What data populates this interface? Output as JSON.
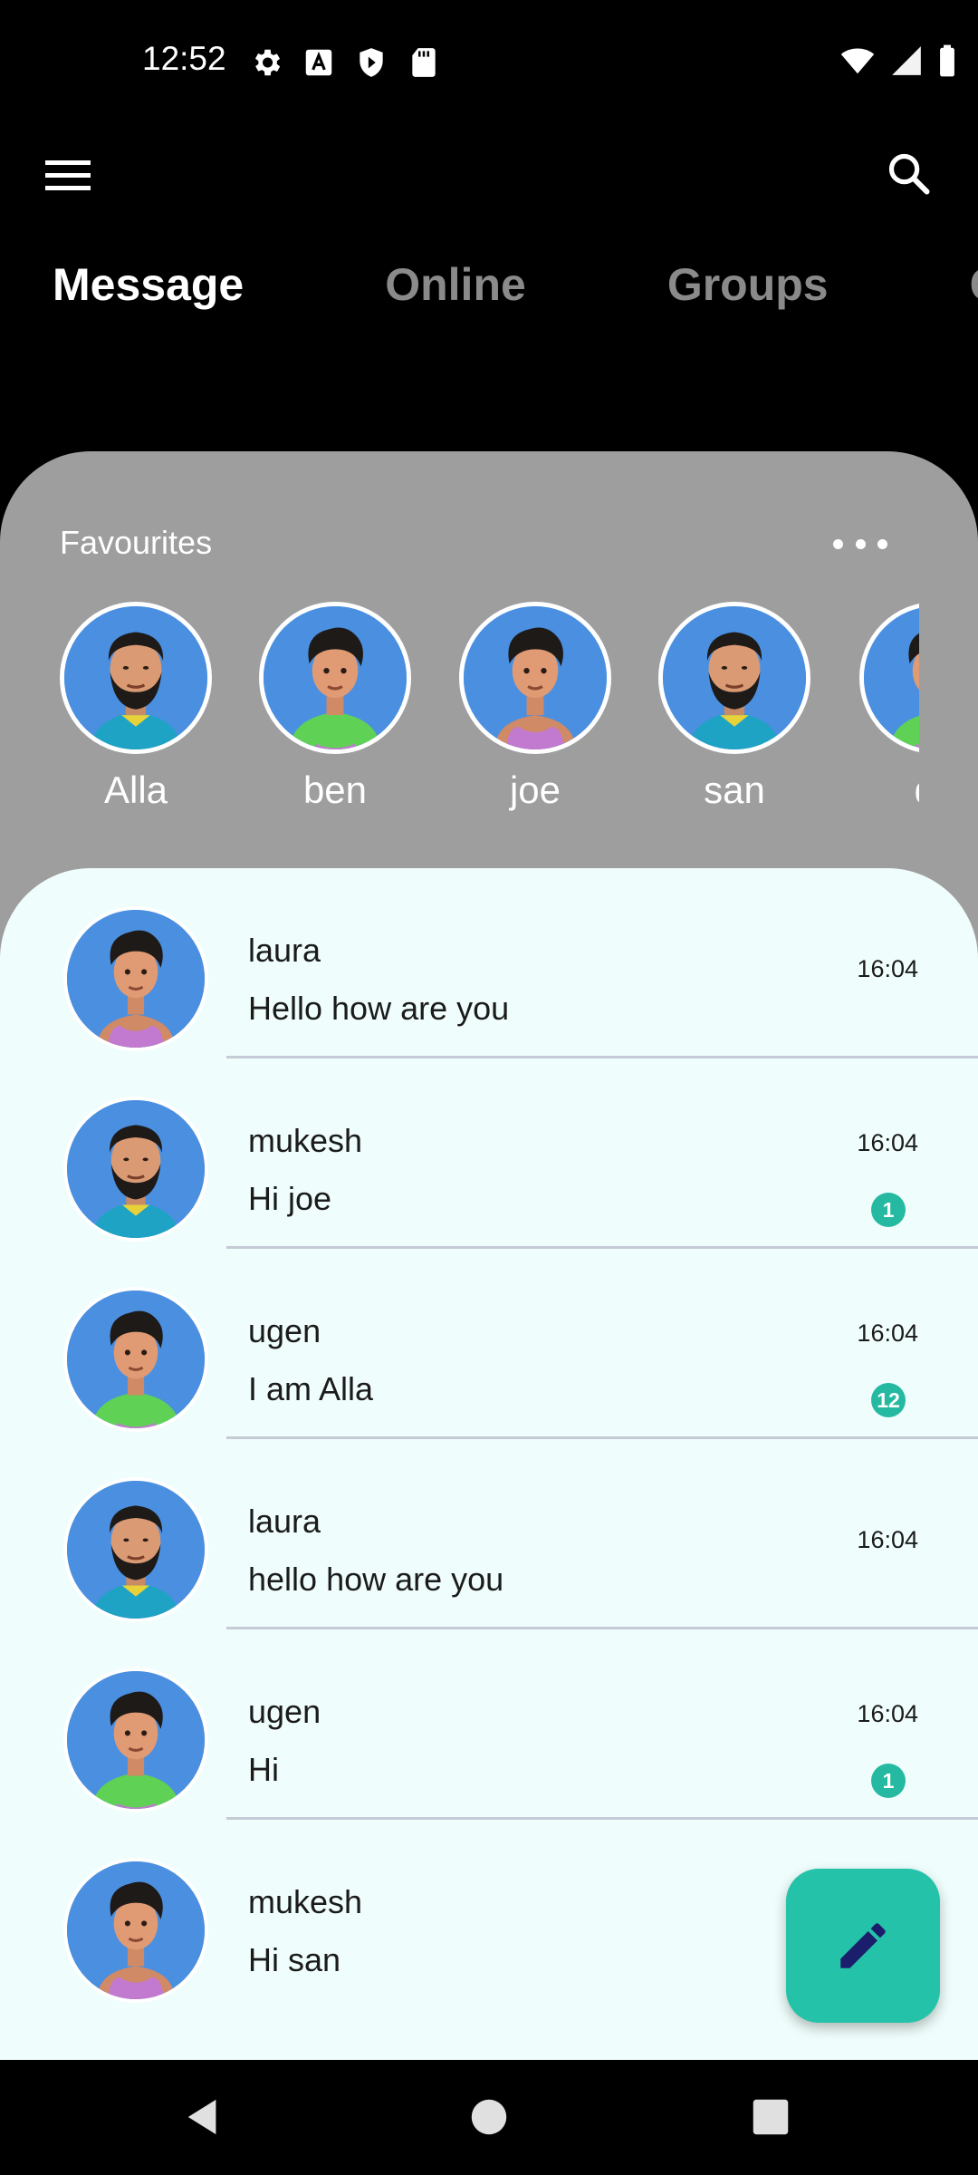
{
  "status_bar": {
    "time": "12:52",
    "left_icons": [
      "gear-icon",
      "font-icon",
      "shield-icon",
      "sd-card-icon"
    ],
    "right_icons": [
      "wifi-icon",
      "signal-icon",
      "battery-icon"
    ]
  },
  "app_bar": {
    "menu_icon": "hamburger-menu-icon",
    "search_icon": "search-icon"
  },
  "tabs": [
    {
      "label": "Message",
      "active": true
    },
    {
      "label": "Online",
      "active": false
    },
    {
      "label": "Groups",
      "active": false
    },
    {
      "label": "C",
      "active": false
    }
  ],
  "favourites": {
    "title": "Favourites",
    "more_icon": "more-horizontal-icon",
    "items": [
      {
        "name": "Alla",
        "avatar": "bearded-man-teal-shirt"
      },
      {
        "name": "ben",
        "avatar": "man-green-shirt"
      },
      {
        "name": "joe",
        "avatar": "man-purple-tank"
      },
      {
        "name": "san",
        "avatar": "bearded-man-teal-shirt"
      },
      {
        "name": "du",
        "avatar": "man-green-shirt"
      }
    ]
  },
  "chats": [
    {
      "name": "laura",
      "message": "Hello how are you",
      "time": "16:04",
      "unread": "",
      "avatar": "man-purple-tank"
    },
    {
      "name": "mukesh",
      "message": "Hi joe",
      "time": "16:04",
      "unread": "1",
      "avatar": "bearded-man-teal-shirt"
    },
    {
      "name": "ugen",
      "message": "I am Alla",
      "time": "16:04",
      "unread": "12",
      "avatar": "man-green-shirt"
    },
    {
      "name": "laura",
      "message": "hello how are you",
      "time": "16:04",
      "unread": "",
      "avatar": "bearded-man-teal-shirt"
    },
    {
      "name": "ugen",
      "message": "Hi",
      "time": "16:04",
      "unread": "1",
      "avatar": "man-green-shirt"
    },
    {
      "name": "mukesh",
      "message": "Hi san",
      "time": "",
      "unread": "",
      "avatar": "man-purple-tank"
    }
  ],
  "fab": {
    "icon": "edit-pencil-icon"
  },
  "nav_bar": {
    "icons": [
      "back-triangle-icon",
      "home-circle-icon",
      "recents-square-icon"
    ]
  },
  "colors": {
    "background": "#000000",
    "favourites_panel": "#9e9e9e",
    "chat_panel": "#effefc",
    "accent": "#25c2aa",
    "badge": "#25b9a2",
    "inactive_tab": "#8a8a8a",
    "avatar_bg": "#4a8fe0"
  }
}
